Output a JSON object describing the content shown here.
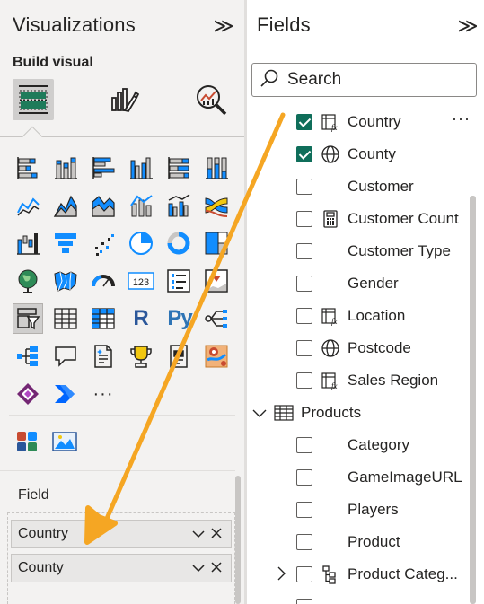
{
  "visualizations": {
    "title": "Visualizations",
    "collapse_glyph": "≫",
    "build_visual_label": "Build visual",
    "modes": [
      {
        "icon": "build-visual-icon",
        "selected": true
      },
      {
        "icon": "format-visual-icon",
        "selected": false
      },
      {
        "icon": "analytics-icon",
        "selected": false
      }
    ],
    "gallery": [
      {
        "icon": "stacked-bar-chart-icon"
      },
      {
        "icon": "stacked-column-chart-icon"
      },
      {
        "icon": "clustered-bar-chart-icon"
      },
      {
        "icon": "clustered-column-chart-icon"
      },
      {
        "icon": "100-percent-stacked-bar-chart-icon"
      },
      {
        "icon": "100-percent-stacked-column-chart-icon"
      },
      {
        "icon": "line-chart-icon"
      },
      {
        "icon": "area-chart-icon"
      },
      {
        "icon": "stacked-area-chart-icon"
      },
      {
        "icon": "line-and-stacked-column-chart-icon"
      },
      {
        "icon": "line-and-clustered-column-chart-icon"
      },
      {
        "icon": "ribbon-chart-icon"
      },
      {
        "icon": "waterfall-chart-icon"
      },
      {
        "icon": "funnel-icon"
      },
      {
        "icon": "scatter-chart-icon"
      },
      {
        "icon": "pie-chart-icon"
      },
      {
        "icon": "donut-chart-icon"
      },
      {
        "icon": "treemap-icon"
      },
      {
        "icon": "map-icon"
      },
      {
        "icon": "filled-map-icon"
      },
      {
        "icon": "gauge-icon"
      },
      {
        "icon": "card-icon",
        "text": "123"
      },
      {
        "icon": "multi-row-card-icon"
      },
      {
        "icon": "kpi-icon"
      },
      {
        "icon": "slicer-icon",
        "selected": true
      },
      {
        "icon": "table-icon"
      },
      {
        "icon": "matrix-icon"
      },
      {
        "icon": "r-script-visual-icon",
        "text": "R"
      },
      {
        "icon": "python-visual-icon",
        "text": "Py"
      },
      {
        "icon": "key-influencers-icon"
      },
      {
        "icon": "decomposition-tree-icon"
      },
      {
        "icon": "qa-icon"
      },
      {
        "icon": "smart-narrative-icon"
      },
      {
        "icon": "metrics-icon"
      },
      {
        "icon": "paginated-report-icon"
      },
      {
        "icon": "azure-map-icon"
      },
      {
        "icon": "power-apps-icon"
      },
      {
        "icon": "power-automate-icon"
      },
      {
        "icon": "more-visuals-icon",
        "text": "···"
      }
    ],
    "extras": [
      {
        "icon": "get-more-visuals-icon"
      },
      {
        "icon": "image-visual-icon"
      }
    ],
    "field_well": {
      "label": "Field",
      "items": [
        {
          "label": "Country"
        },
        {
          "label": "County"
        }
      ]
    }
  },
  "fields": {
    "title": "Fields",
    "collapse_glyph": "≫",
    "search": {
      "placeholder": "Search"
    },
    "rows": [
      {
        "type": "field",
        "label": "Country",
        "checked": true,
        "icon": "hierarchy-calc-icon",
        "more": "···"
      },
      {
        "type": "field",
        "label": "County",
        "checked": true,
        "icon": "globe-icon"
      },
      {
        "type": "field",
        "label": "Customer",
        "checked": false,
        "icon": ""
      },
      {
        "type": "field",
        "label": "Customer Count",
        "checked": false,
        "icon": "calculator-icon"
      },
      {
        "type": "field",
        "label": "Customer Type",
        "checked": false,
        "icon": ""
      },
      {
        "type": "field",
        "label": "Gender",
        "checked": false,
        "icon": ""
      },
      {
        "type": "field",
        "label": "Location",
        "checked": false,
        "icon": "hierarchy-calc-icon"
      },
      {
        "type": "field",
        "label": "Postcode",
        "checked": false,
        "icon": "globe-icon"
      },
      {
        "type": "field",
        "label": "Sales Region",
        "checked": false,
        "icon": "hierarchy-calc-icon"
      },
      {
        "type": "table",
        "label": "Products",
        "expanded": true,
        "icon": "table-icon"
      },
      {
        "type": "field",
        "label": "Category",
        "checked": false,
        "icon": ""
      },
      {
        "type": "field",
        "label": "GameImageURL",
        "checked": false,
        "icon": ""
      },
      {
        "type": "field",
        "label": "Players",
        "checked": false,
        "icon": ""
      },
      {
        "type": "field",
        "label": "Product",
        "checked": false,
        "icon": ""
      },
      {
        "type": "hierarchy",
        "label": "Product Categ...",
        "checked": false,
        "icon": "hierarchy-icon",
        "expanded": false
      }
    ]
  },
  "annotation": {
    "icon": "drag-arrow-icon",
    "color": "#f5a623"
  }
}
